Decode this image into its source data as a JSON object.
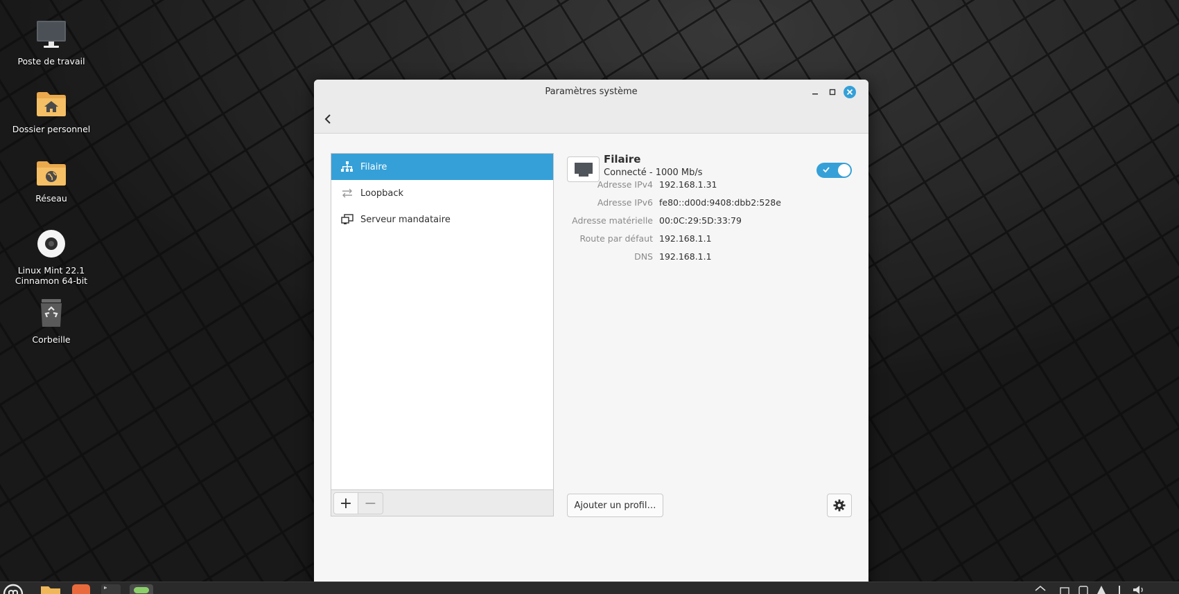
{
  "desktop": {
    "icons": [
      {
        "label": "Poste de travail",
        "icon": "monitor-icon"
      },
      {
        "label": "Dossier personnel",
        "icon": "home-folder-icon"
      },
      {
        "label": "Réseau",
        "icon": "network-folder-icon"
      },
      {
        "label": "Linux Mint 22.1 Cinnamon 64-bit",
        "icon": "disc-icon"
      },
      {
        "label": "Corbeille",
        "icon": "trash-icon"
      }
    ]
  },
  "window": {
    "title": "Paramètres système",
    "back_icon": "chevron-left-icon",
    "list": {
      "items": [
        {
          "label": "Filaire",
          "icon": "wired-network-icon",
          "selected": true
        },
        {
          "label": "Loopback",
          "icon": "loopback-arrows-icon",
          "selected": false
        },
        {
          "label": "Serveur mandataire",
          "icon": "proxy-icon",
          "selected": false
        }
      ],
      "add_label": "+",
      "remove_label": "−"
    },
    "device": {
      "name": "Filaire",
      "status": "Connecté - 1000 Mb/s",
      "enabled": true,
      "details": [
        {
          "key": "Adresse IPv4",
          "value": "192.168.1.31"
        },
        {
          "key": "Adresse IPv6",
          "value": "fe80::d00d:9408:dbb2:528e"
        },
        {
          "key": "Adresse matérielle",
          "value": "00:0C:29:5D:33:79"
        },
        {
          "key": "Route par défaut",
          "value": "192.168.1.1"
        },
        {
          "key": "DNS",
          "value": "192.168.1.1"
        }
      ],
      "add_profile_label": "Ajouter un profil…",
      "settings_icon": "gear-icon"
    }
  },
  "colors": {
    "accent": "#35a0d8",
    "folder": "#f0b65a",
    "window_bg": "#f6f6f6"
  }
}
